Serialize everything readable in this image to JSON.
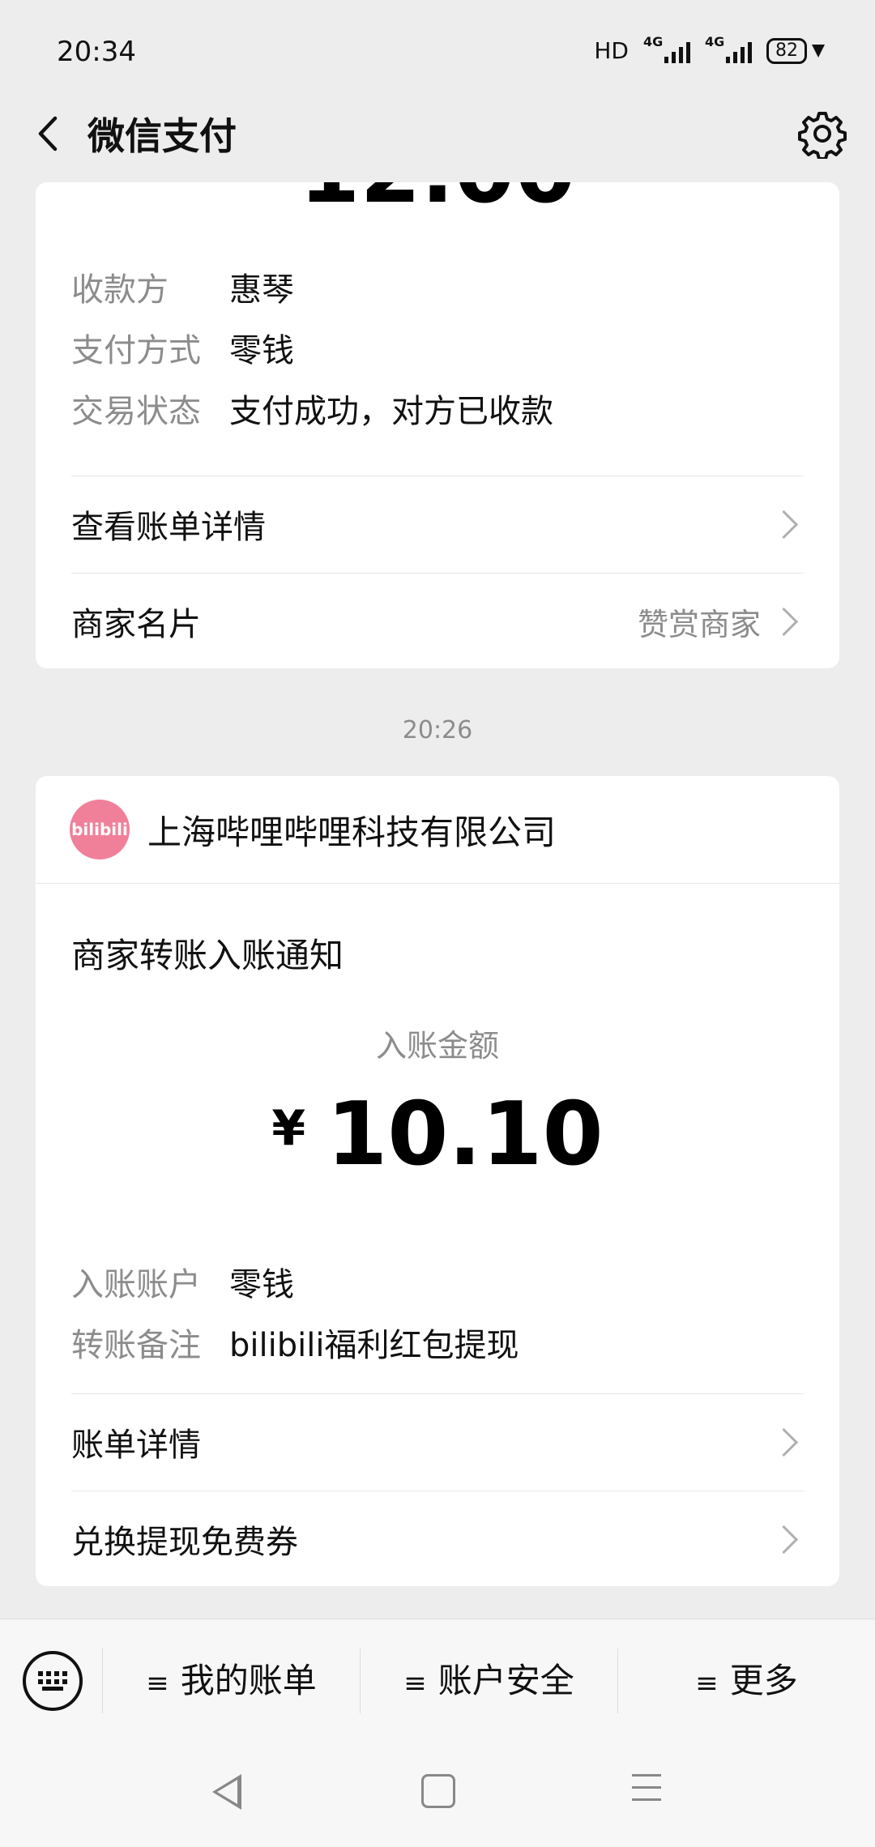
{
  "status_bar": {
    "time": "20:34",
    "network": "HD",
    "sim1": "4G",
    "sim2": "4G",
    "battery": "82"
  },
  "header": {
    "title": "微信支付"
  },
  "card1": {
    "amount_partial": "12.00",
    "info": [
      {
        "key": "收款方",
        "value": "惠琴"
      },
      {
        "key": "支付方式",
        "value": "零钱"
      },
      {
        "key": "交易状态",
        "value": "支付成功，对方已收款"
      }
    ],
    "rows": [
      {
        "label": "查看账单详情",
        "right": ""
      },
      {
        "label": "商家名片",
        "right": "赞赏商家"
      }
    ]
  },
  "time_separator": "20:26",
  "card2": {
    "merchant_logo_text": "bilibili",
    "merchant_name": "上海哔哩哔哩科技有限公司",
    "notice_title": "商家转账入账通知",
    "amount_label": "入账金额",
    "currency": "¥",
    "amount": "10.10",
    "info": [
      {
        "key": "入账账户",
        "value": "零钱"
      },
      {
        "key": "转账备注",
        "value": "bilibili福利红包提现"
      }
    ],
    "rows": [
      {
        "label": "账单详情"
      },
      {
        "label": "兑换提现免费券"
      }
    ]
  },
  "bottom_menu": {
    "items": [
      {
        "label": "我的账单"
      },
      {
        "label": "账户安全"
      },
      {
        "label": "更多"
      }
    ]
  },
  "colors": {
    "background": "#ededed",
    "card": "#ffffff",
    "secondary_text": "#8c8c8c",
    "bilibili_pink": "#f0809a"
  }
}
